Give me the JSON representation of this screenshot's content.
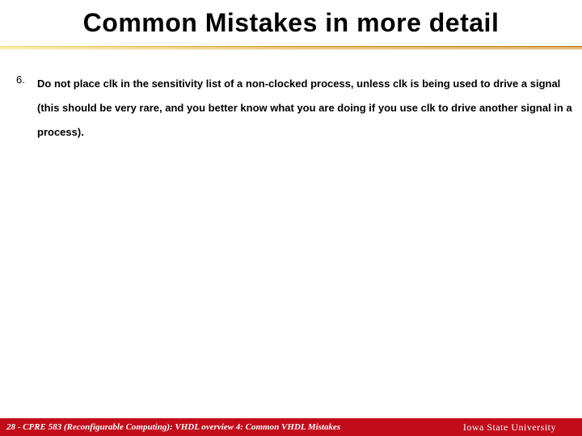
{
  "slide": {
    "title": "Common Mistakes in more detail",
    "bullet": {
      "number": "6.",
      "text": "Do not place clk in the sensitivity list of a non-clocked process, unless clk is being used to drive a signal (this should be very rare, and you better know what you are doing if you use clk to drive another signal in a process)."
    }
  },
  "footer": {
    "left": "28 - CPRE 583 (Reconfigurable Computing):  VHDL overview 4: Common VHDL Mistakes",
    "right": "Iowa State University"
  }
}
